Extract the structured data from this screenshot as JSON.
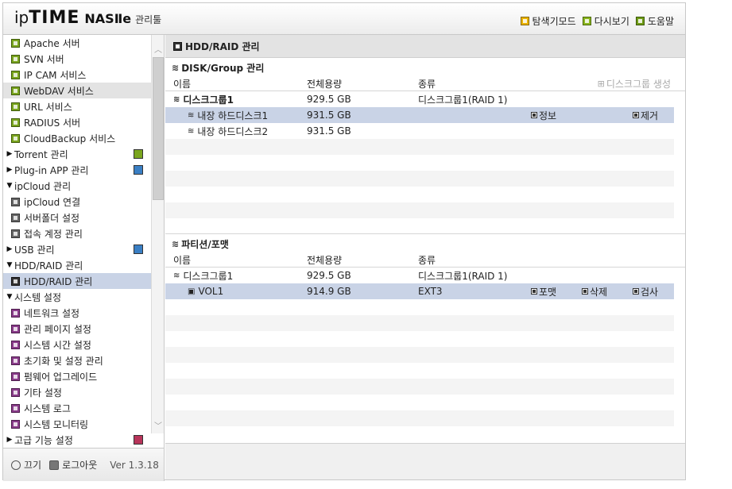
{
  "header": {
    "logo_ip": "ip",
    "logo_time": "TIME",
    "logo_nas": "NASⅡe",
    "logo_tool": "관리툴",
    "links": [
      {
        "label": "탐색기모드",
        "icon": "explorer-icon"
      },
      {
        "label": "다시보기",
        "icon": "refresh-icon"
      },
      {
        "label": "도움말",
        "icon": "help-icon"
      }
    ]
  },
  "sidebar": {
    "items": [
      {
        "label": "Apache 서버",
        "type": "sub",
        "icon": "green"
      },
      {
        "label": "SVN 서버",
        "type": "sub",
        "icon": "green"
      },
      {
        "label": "IP CAM 서비스",
        "type": "sub",
        "icon": "green"
      },
      {
        "label": "WebDAV 서비스",
        "type": "sub",
        "icon": "green",
        "state": "hover"
      },
      {
        "label": "URL 서비스",
        "type": "sub",
        "icon": "green"
      },
      {
        "label": "RADIUS 서버",
        "type": "sub",
        "icon": "green"
      },
      {
        "label": "CloudBackup 서비스",
        "type": "sub",
        "icon": "green"
      },
      {
        "label": "Torrent 관리",
        "type": "cat",
        "expanded": false,
        "caticon": "green"
      },
      {
        "label": "Plug-in APP 관리",
        "type": "cat",
        "expanded": false,
        "caticon": "blue"
      },
      {
        "label": "ipCloud 관리",
        "type": "cat",
        "expanded": true
      },
      {
        "label": "ipCloud 연결",
        "type": "sub",
        "icon": "gray"
      },
      {
        "label": "서버폴더 설정",
        "type": "sub",
        "icon": "gray"
      },
      {
        "label": "접속 계정 관리",
        "type": "sub",
        "icon": "gray"
      },
      {
        "label": "USB 관리",
        "type": "cat",
        "expanded": false,
        "caticon": "blue"
      },
      {
        "label": "HDD/RAID 관리",
        "type": "cat",
        "expanded": true
      },
      {
        "label": "HDD/RAID 관리",
        "type": "sub",
        "icon": "dark",
        "state": "selected"
      },
      {
        "label": "시스템 설정",
        "type": "cat",
        "expanded": true
      },
      {
        "label": "네트워크 설정",
        "type": "sub",
        "icon": "purple"
      },
      {
        "label": "관리 페이지 설정",
        "type": "sub",
        "icon": "purple"
      },
      {
        "label": "시스템 시간 설정",
        "type": "sub",
        "icon": "purple"
      },
      {
        "label": "초기화 및 설정 관리",
        "type": "sub",
        "icon": "purple"
      },
      {
        "label": "펌웨어 업그레이드",
        "type": "sub",
        "icon": "purple"
      },
      {
        "label": "기타 설정",
        "type": "sub",
        "icon": "purple"
      },
      {
        "label": "시스템 로그",
        "type": "sub",
        "icon": "purple"
      },
      {
        "label": "시스템 모니터링",
        "type": "sub",
        "icon": "purple"
      },
      {
        "label": "고급 기능 설정",
        "type": "cat",
        "expanded": false,
        "caticon": "red"
      }
    ]
  },
  "footer": {
    "power_label": "끄기",
    "logout_label": "로그아웃",
    "version": "Ver 1.3.18"
  },
  "main": {
    "title": "HDD/RAID 관리",
    "disk_section": {
      "title": "DISK/Group 관리",
      "create_label": "디스크그룹 생성",
      "columns": [
        "이름",
        "전체용량",
        "종류"
      ],
      "rows": [
        {
          "name": "디스크그룹1",
          "size": "929.5 GB",
          "kind": "디스크그룹1(RAID 1)",
          "bold": true
        },
        {
          "name": "내장 하드디스크1",
          "size": "931.5 GB",
          "kind": "",
          "selected": true,
          "actions": [
            "정보",
            "제거"
          ]
        },
        {
          "name": "내장 하드디스크2",
          "size": "931.5 GB",
          "kind": ""
        }
      ]
    },
    "partition_section": {
      "title": "파티션/포맷",
      "columns": [
        "이름",
        "전체용량",
        "종류"
      ],
      "rows": [
        {
          "name": "디스크그룹1",
          "size": "929.5 GB",
          "kind": "디스크그룹1(RAID 1)"
        },
        {
          "name": "VOL1",
          "size": "914.9 GB",
          "kind": "EXT3",
          "selected": true,
          "actions": [
            "포맷",
            "삭제",
            "검사"
          ]
        }
      ]
    }
  },
  "colors": {
    "selected_row": "#c9d3e6",
    "title_bar": "#e3e3e3"
  }
}
